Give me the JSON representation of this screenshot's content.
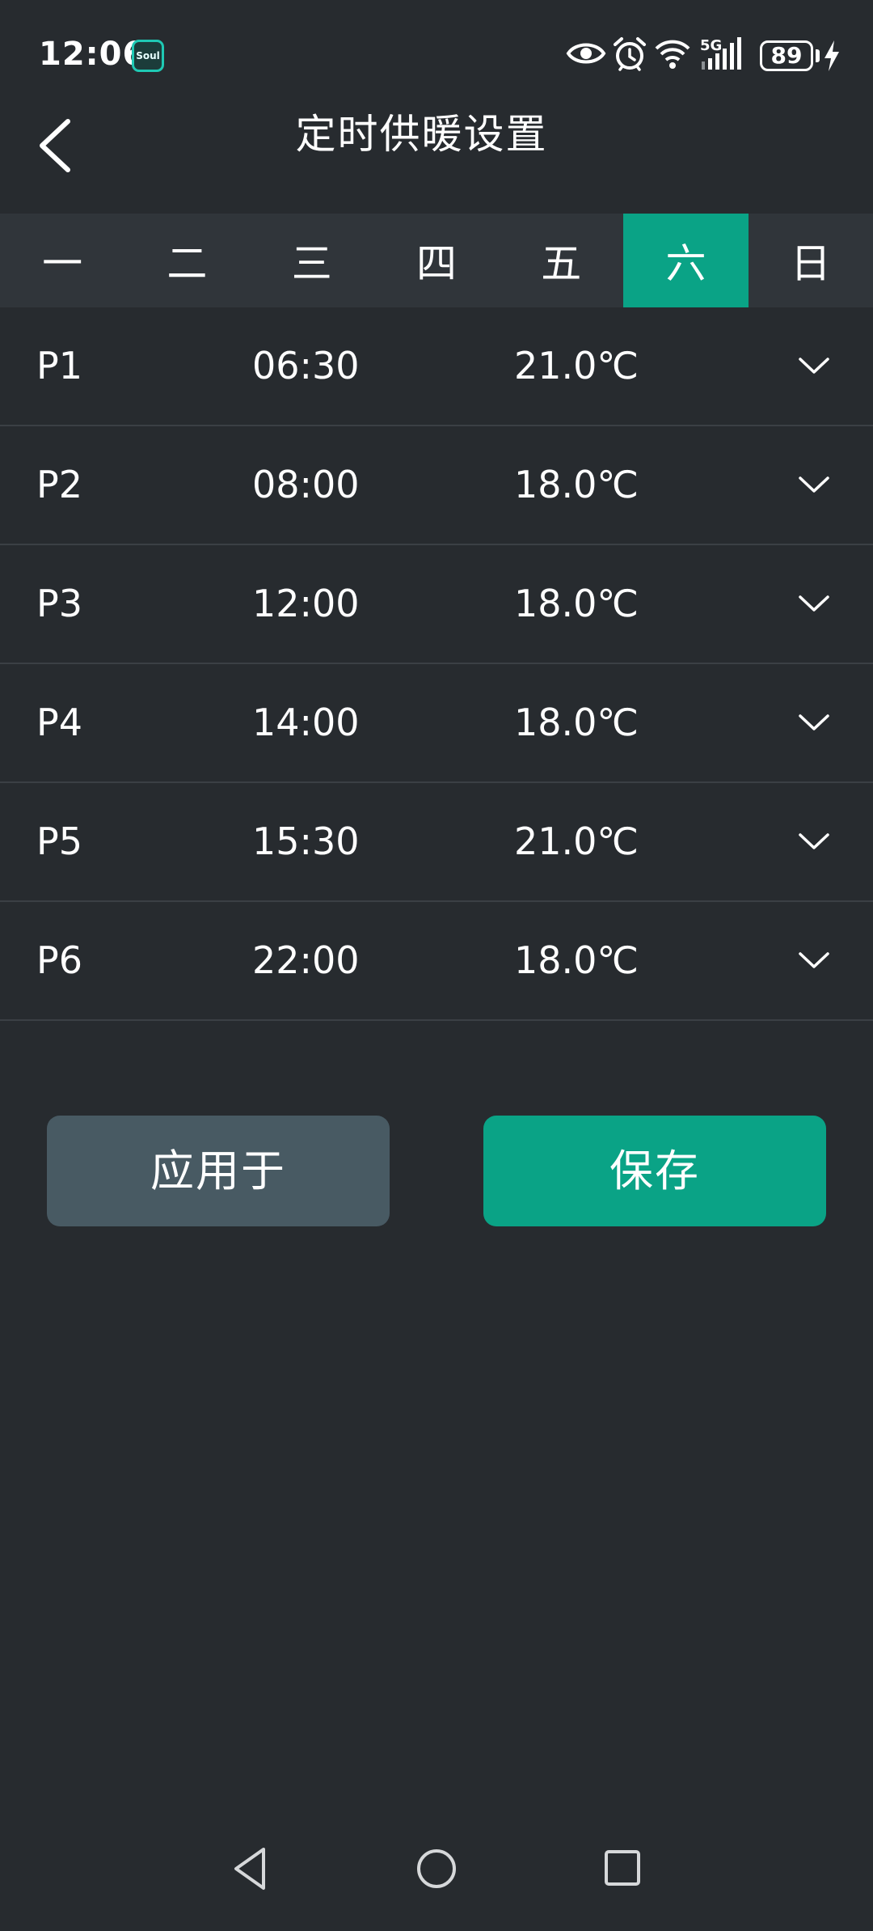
{
  "status_bar": {
    "time": "12:06",
    "app_badge": "Soul",
    "network": "5G",
    "battery": "89"
  },
  "header": {
    "title": "定时供暖设置"
  },
  "days": [
    {
      "label": "一",
      "active": false
    },
    {
      "label": "二",
      "active": false
    },
    {
      "label": "三",
      "active": false
    },
    {
      "label": "四",
      "active": false
    },
    {
      "label": "五",
      "active": false
    },
    {
      "label": "六",
      "active": true
    },
    {
      "label": "日",
      "active": false
    }
  ],
  "periods": [
    {
      "label": "P1",
      "time": "06:30",
      "temp": "21.0℃"
    },
    {
      "label": "P2",
      "time": "08:00",
      "temp": "18.0℃"
    },
    {
      "label": "P3",
      "time": "12:00",
      "temp": "18.0℃"
    },
    {
      "label": "P4",
      "time": "14:00",
      "temp": "18.0℃"
    },
    {
      "label": "P5",
      "time": "15:30",
      "temp": "21.0℃"
    },
    {
      "label": "P6",
      "time": "22:00",
      "temp": "18.0℃"
    }
  ],
  "actions": {
    "apply_label": "应用于",
    "save_label": "保存"
  },
  "colors": {
    "background": "#272b2f",
    "accent": "#0aa386",
    "secondary_button": "#485a63"
  }
}
